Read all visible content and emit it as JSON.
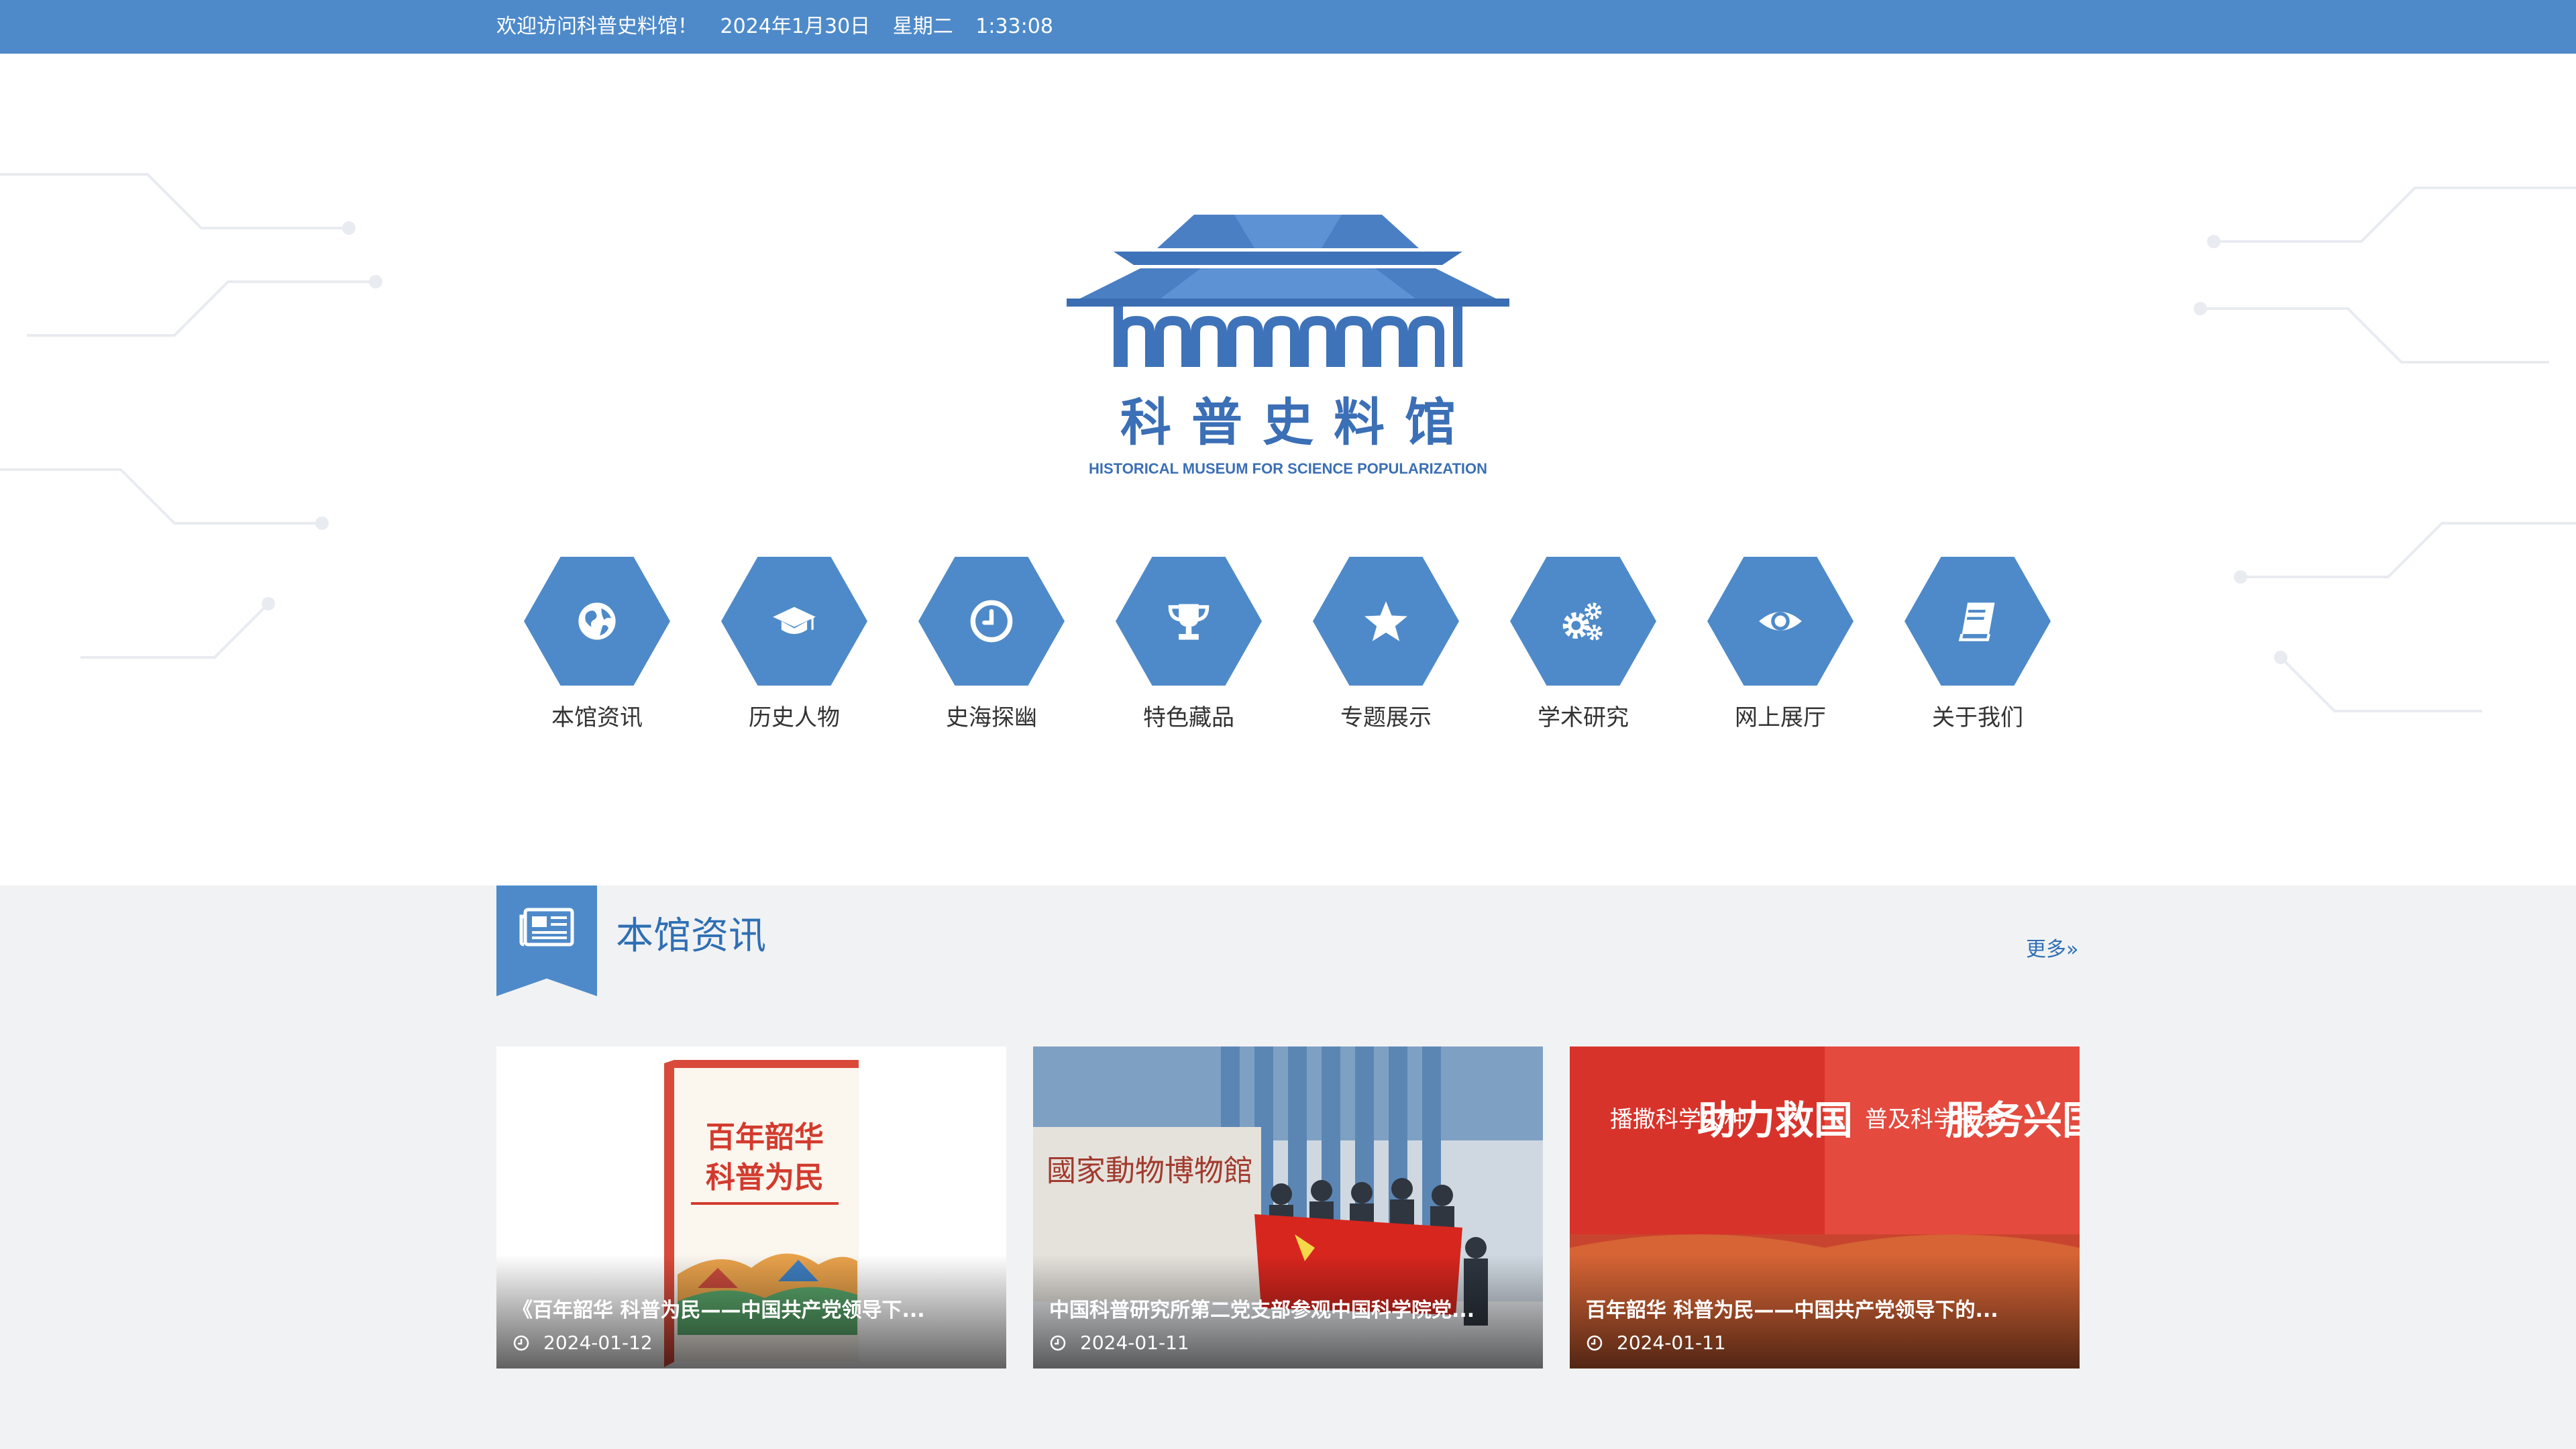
{
  "topbar": {
    "welcome": "欢迎访问科普史料馆！",
    "date": "2024年1月30日",
    "weekday": "星期二",
    "time": "1:33:08"
  },
  "logo": {
    "name_cn": "科普史料馆",
    "name_en": "HISTORICAL MUSEUM FOR SCIENCE POPULARIZATION"
  },
  "nav": {
    "items": [
      {
        "label": "本馆资讯",
        "icon": "globe-icon"
      },
      {
        "label": "历史人物",
        "icon": "graduation-cap-icon"
      },
      {
        "label": "史海探幽",
        "icon": "clock-icon"
      },
      {
        "label": "特色藏品",
        "icon": "trophy-icon"
      },
      {
        "label": "专题展示",
        "icon": "star-icon"
      },
      {
        "label": "学术研究",
        "icon": "gears-icon"
      },
      {
        "label": "网上展厅",
        "icon": "eye-icon"
      },
      {
        "label": "关于我们",
        "icon": "book-icon"
      }
    ]
  },
  "news": {
    "section_title": "本馆资讯",
    "section_icon": "newspaper-icon",
    "more_label": "更多»",
    "cards": [
      {
        "title": "《百年韶华 科普为民——中国共产党领导下...",
        "date": "2024-01-12"
      },
      {
        "title": "中国科普研究所第二党支部参观中国科学院党...",
        "date": "2024-01-11"
      },
      {
        "title": "百年韶华 科普为民——中国共产党领导下的...",
        "date": "2024-01-11"
      }
    ]
  },
  "colors": {
    "brand": "#4e8ac9",
    "title_blue": "#2f6fb4",
    "section_bg": "#f1f2f4"
  }
}
